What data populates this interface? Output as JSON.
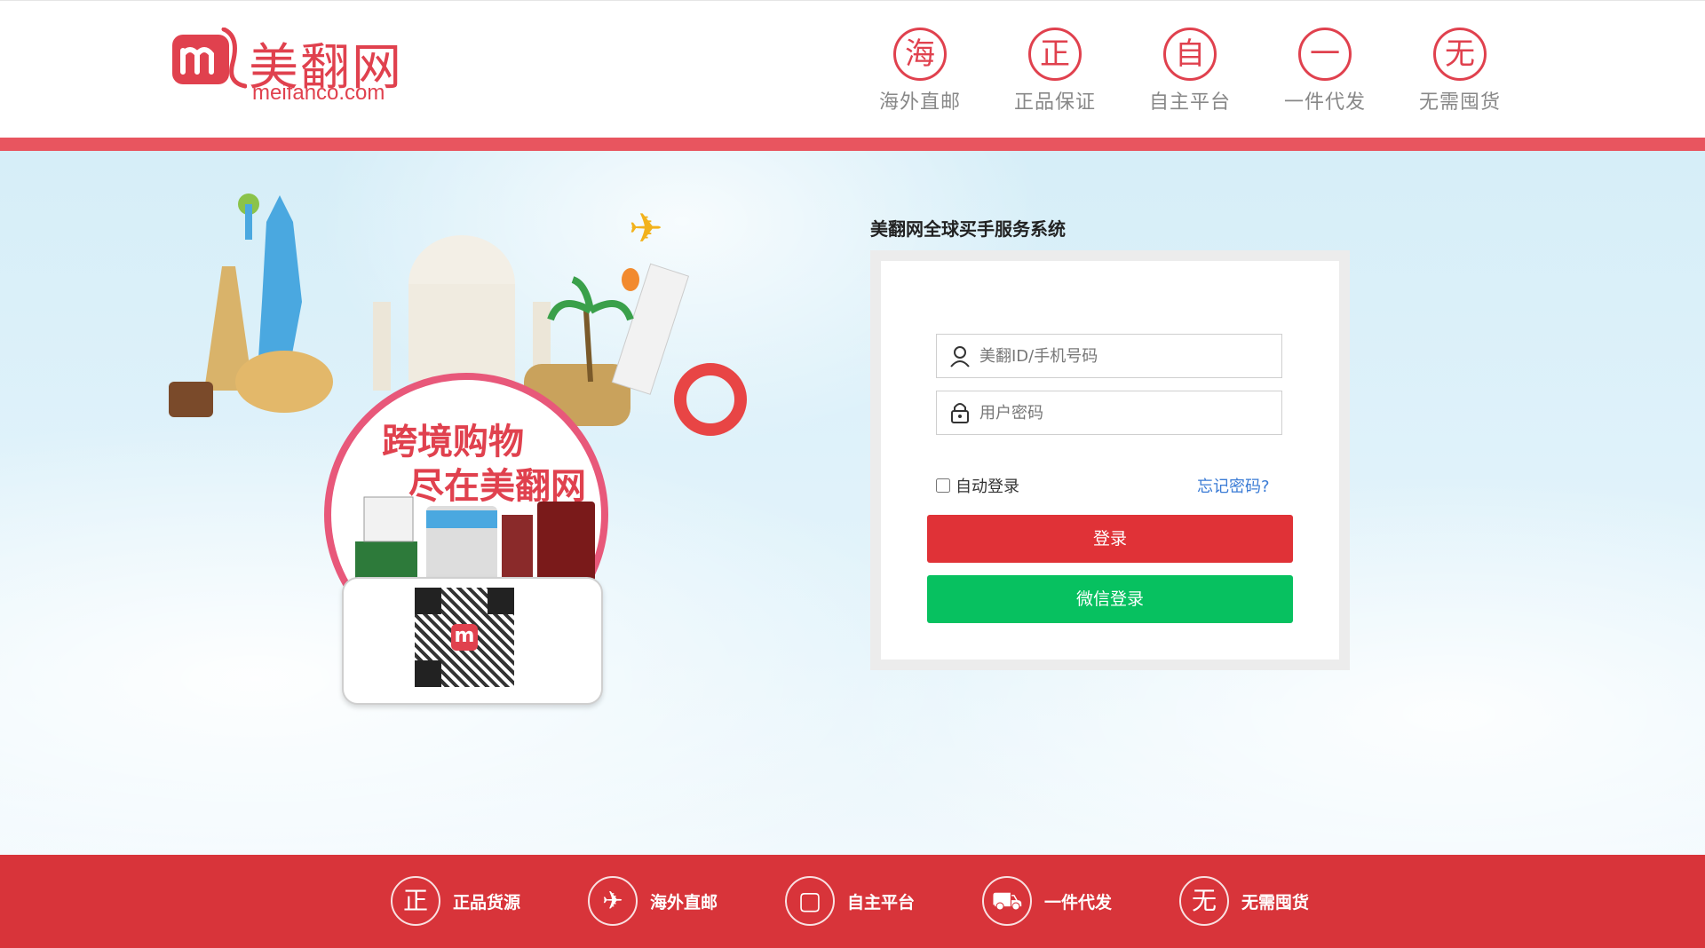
{
  "header": {
    "logo_cn": "美翻网",
    "logo_en": "meifanco.com",
    "logo_mark": "m",
    "features": [
      {
        "icon_char": "海",
        "label": "海外直邮"
      },
      {
        "icon_char": "正",
        "label": "正品保证"
      },
      {
        "icon_char": "自",
        "label": "自主平台"
      },
      {
        "icon_char": "一",
        "label": "一件代发"
      },
      {
        "icon_char": "无",
        "label": "无需囤货"
      }
    ]
  },
  "hero": {
    "slogan_line1": "跨境购物",
    "slogan_line2": "尽在美翻网",
    "qr_badge": "m"
  },
  "login": {
    "title": "美翻网全球买手服务系统",
    "username_placeholder": "美翻ID/手机号码",
    "password_placeholder": "用户密码",
    "remember_label": "自动登录",
    "forgot_label": "忘记密码?",
    "login_button": "登录",
    "wechat_button": "微信登录"
  },
  "footer": {
    "items": [
      {
        "icon_char": "正",
        "icon": "zheng-icon",
        "label": "正品货源"
      },
      {
        "icon_char": "✈",
        "icon": "plane-icon",
        "label": "海外直邮"
      },
      {
        "icon_char": "▢",
        "icon": "monitor-icon",
        "label": "自主平台"
      },
      {
        "icon_char": "⛟",
        "icon": "truck-icon",
        "label": "一件代发"
      },
      {
        "icon_char": "无",
        "icon": "wu-icon",
        "label": "无需囤货"
      }
    ]
  },
  "colors": {
    "brand_red": "#e0414e",
    "login_red": "#e03237",
    "wechat_green": "#07c160",
    "footer_red": "#d8343a"
  }
}
